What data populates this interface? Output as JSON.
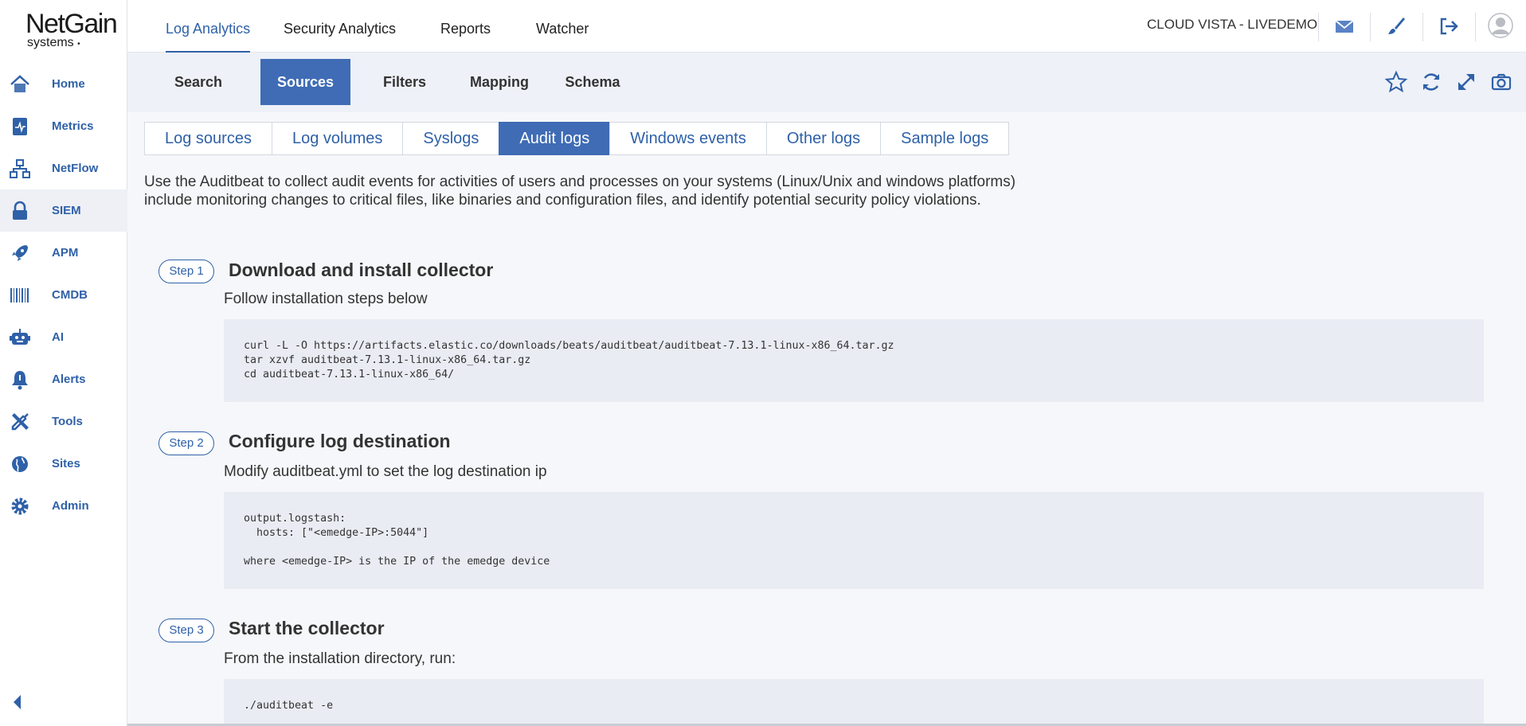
{
  "brand": {
    "line1": "NetGain",
    "line2": "systems",
    "mark": "•"
  },
  "sidebar": {
    "items": [
      {
        "label": "Home",
        "icon": "home-icon"
      },
      {
        "label": "Metrics",
        "icon": "metrics-icon"
      },
      {
        "label": "NetFlow",
        "icon": "netflow-icon"
      },
      {
        "label": "SIEM",
        "icon": "lock-icon",
        "active": true
      },
      {
        "label": "APM",
        "icon": "rocket-icon"
      },
      {
        "label": "CMDB",
        "icon": "barcode-icon"
      },
      {
        "label": "AI",
        "icon": "robot-icon"
      },
      {
        "label": "Alerts",
        "icon": "bell-icon"
      },
      {
        "label": "Tools",
        "icon": "tools-icon"
      },
      {
        "label": "Sites",
        "icon": "sites-icon"
      },
      {
        "label": "Admin",
        "icon": "gear-icon"
      }
    ],
    "collapse_icon": "chevron-left-icon"
  },
  "topnav": {
    "tabs": [
      "Log Analytics",
      "Security Analytics",
      "Reports",
      "Watcher"
    ],
    "active": "Log Analytics",
    "tenant": "CLOUD VISTA - LIVEDEMO",
    "icons": [
      "mail-icon",
      "brush-icon",
      "logout-icon",
      "user-avatar-icon"
    ]
  },
  "subnav": {
    "tabs": [
      "Search",
      "Sources",
      "Filters",
      "Mapping",
      "Schema"
    ],
    "active": "Sources",
    "icons": [
      "star-icon",
      "refresh-icon",
      "expand-icon",
      "camera-icon"
    ]
  },
  "content": {
    "tabs": [
      "Log sources",
      "Log volumes",
      "Syslogs",
      "Audit logs",
      "Windows events",
      "Other logs",
      "Sample logs"
    ],
    "active_tab": "Audit logs",
    "intro_line1": "Use the Auditbeat to collect audit events for activities of users and processes on your systems (Linux/Unix and windows platforms)",
    "intro_line2": "include monitoring changes to critical files, like binaries and configuration files, and identify potential security policy violations.",
    "steps": [
      {
        "badge": "Step 1",
        "title": "Download and install collector",
        "desc": "Follow installation steps below",
        "code": "curl -L -O https://artifacts.elastic.co/downloads/beats/auditbeat/auditbeat-7.13.1-linux-x86_64.tar.gz\ntar xzvf auditbeat-7.13.1-linux-x86_64.tar.gz\ncd auditbeat-7.13.1-linux-x86_64/"
      },
      {
        "badge": "Step 2",
        "title": "Configure log destination",
        "desc": "Modify auditbeat.yml to set the log destination ip",
        "code": "output.logstash:\n  hosts: [\"<emedge-IP>:5044\"]\n\nwhere <emedge-IP> is the IP of the emedge device"
      },
      {
        "badge": "Step 3",
        "title": "Start the collector",
        "desc": "From the installation directory, run:",
        "code": "./auditbeat -e"
      }
    ]
  },
  "colors": {
    "accent": "#3f6cb5",
    "link": "#2f61a8",
    "subbar": "#eef1f7",
    "code_bg": "#e9ecf3"
  }
}
